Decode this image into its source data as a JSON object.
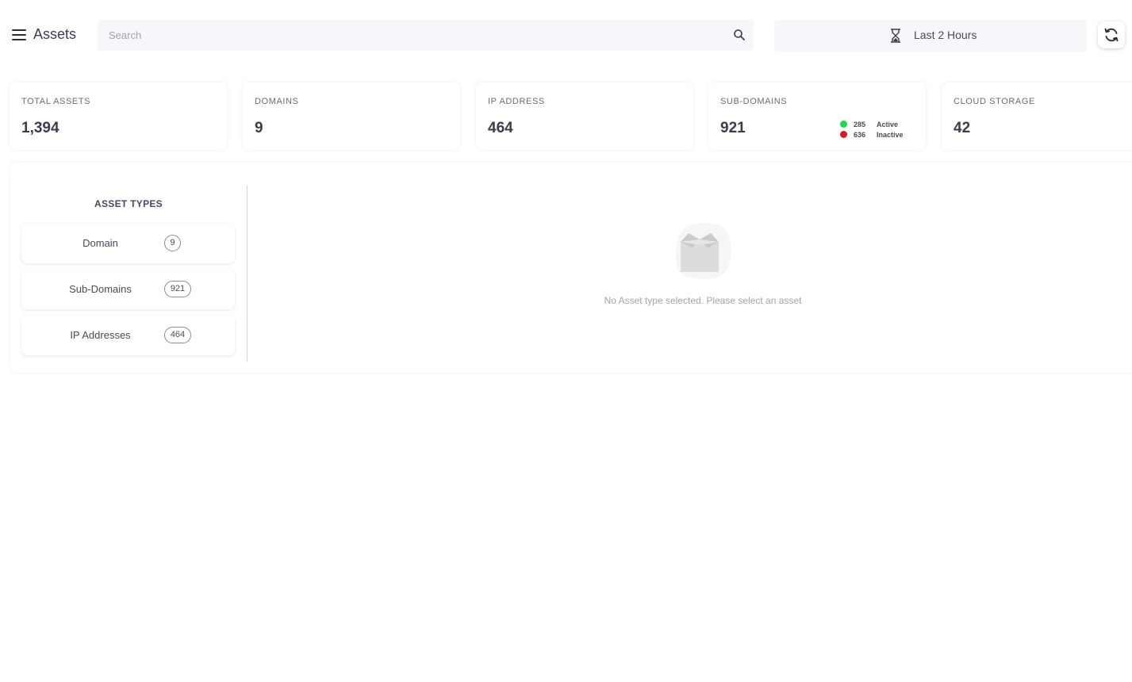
{
  "header": {
    "title": "Assets",
    "search_placeholder": "Search",
    "time_range": "Last 2 Hours"
  },
  "stats": [
    {
      "label": "TOTAL ASSETS",
      "value": "1,394"
    },
    {
      "label": "DOMAINS",
      "value": "9"
    },
    {
      "label": "IP ADDRESS",
      "value": "464"
    },
    {
      "label": "SUB-DOMAINS",
      "value": "921",
      "legend": [
        {
          "count": "285",
          "label": "Active",
          "color": "#1ed84a"
        },
        {
          "count": "636",
          "label": "Inactive",
          "color": "#e6151b"
        }
      ]
    },
    {
      "label": "CLOUD STORAGE",
      "value": "42"
    }
  ],
  "asset_types": {
    "title": "ASSET TYPES",
    "items": [
      {
        "label": "Domain",
        "count": "9"
      },
      {
        "label": "Sub-Domains",
        "count": "921"
      },
      {
        "label": "IP Addresses",
        "count": "464"
      }
    ]
  },
  "empty_state": {
    "message": "No Asset type selected. Please select an asset"
  }
}
